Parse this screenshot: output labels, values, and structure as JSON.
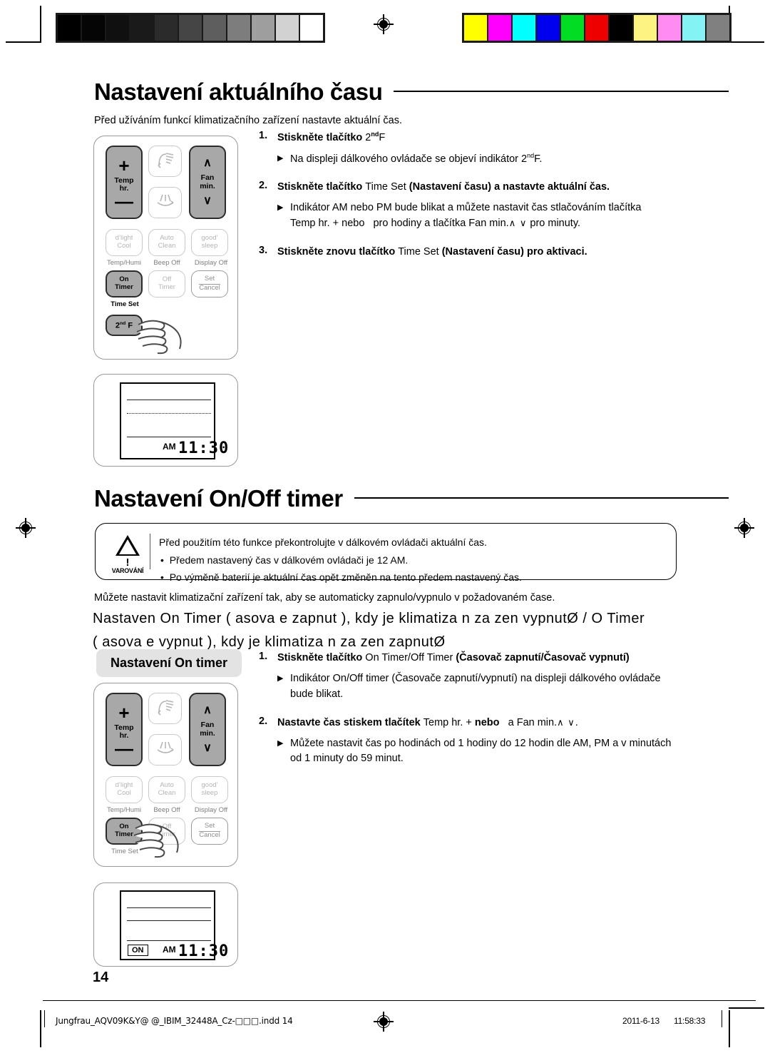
{
  "page": {
    "number": "14",
    "footer_file": "Jungfrau_AQV09K&Y@ @_IBIM_32448A_Cz-□□□.indd   14",
    "footer_date": "2011-6-13",
    "footer_time": "11:58:33"
  },
  "calibration": {
    "gray_swatches": [
      "#000000",
      "#050505",
      "#101010",
      "#1a1a1a",
      "#2b2b2b",
      "#454545",
      "#5e5e5e",
      "#7d7d7d",
      "#9e9e9e",
      "#d2d2d2",
      "#ffffff"
    ],
    "color_swatches": [
      "#ffff00",
      "#ff00ff",
      "#00ffff",
      "#0000ee",
      "#00dd22",
      "#ee0000",
      "#000000",
      "#fdf380",
      "#ff8cf0",
      "#83f3f3",
      "#808080"
    ]
  },
  "section1": {
    "title": "Nastavení aktuálního času",
    "intro": "Před užíváním funkcí klimatizačního zařízení nastavte aktuální čas.",
    "steps": [
      {
        "num": "1.",
        "text_a": "Stiskněte tlačítko ",
        "text_b": "2",
        "sup": "nd",
        "text_c": "F",
        "sub_a": "Na displeji dálkového ovládače se objeví indikátor 2",
        "sub_sup": "nd",
        "sub_b": "F."
      },
      {
        "num": "2.",
        "text_a": "Stiskněte tlačítko ",
        "text_b": "Time Set",
        "text_c": " (Nastavení času) a nastavte aktuální čas.",
        "sub_line1": "Indikátor AM nebo PM bude blikat a můžete nastavit čas stlačováním tlačítka",
        "sub_line2_a": "Temp hr. + nebo",
        "sub_line2_b": "pro hodiny a tlačítka Fan min.",
        "sub_line2_arrows": "∧ ∨",
        "sub_line2_c": "pro minuty."
      },
      {
        "num": "3.",
        "text_a": "Stiskněte znovu tlačítko ",
        "text_b": "Time Set",
        "text_c": " (Nastavení času) pro aktivaci."
      }
    ]
  },
  "section2": {
    "title": "Nastavení On/Off timer",
    "warning": {
      "label": "VAROVÁNÍ",
      "icon": "warning-triangle-icon",
      "line1": "Před použitím této funkce překontrolujte v dálkovém ovládači aktuální čas.",
      "bullets": [
        "Předem nastavený čas v dálkovém ovládači je 12 AM.",
        "Po výměně baterií je aktuální čas opět změněn na tento předem nastavený čas."
      ]
    },
    "para": "Můžete nastavit klimatizační zařízení tak, aby se automaticky zapnulo/vypnulo v požadovaném čase.",
    "glitch_line1": "Nastaven  On Timer (  asova  e zapnut ), kdy  je klimatiza n  za  zen  vypnutØ / O  Timer",
    "glitch_line2": "(  asova  e vypnut ), kdy  je klimatiza n  za  zen  zapnutØ",
    "pill_label": "Nastavení On timer",
    "steps": [
      {
        "num": "1.",
        "text_a": "Stiskněte tlačítko ",
        "text_b": "On Timer/Off Timer",
        "text_c": " (Časovač zapnutí/Časovač vypnutí)",
        "sub_line1": "Indikátor On/Off timer (Časovače zapnutí/vypnutí) na displeji dálkového ovládače",
        "sub_line2": "bude blikat."
      },
      {
        "num": "2.",
        "text_a": "Nastavte čas stiskem tlačítek ",
        "text_b": "Temp hr. +",
        "text_c": " nebo",
        "text_d": "a Fan min.",
        "arrows": "∧ ∨",
        "text_e": "."
      }
    ],
    "step2_subs": [
      "Můžete nastavit čas po hodinách od 1 hodiny do 12 hodin dle AM, PM a v minutách",
      "od 1 minuty do 59 minut."
    ]
  },
  "remote": {
    "temp_label_line1": "Temp",
    "temp_label_line2": "hr.",
    "plus": "+",
    "minus": "—",
    "fan_label_line1": "Fan",
    "fan_label_line2": "min.",
    "chevron_up": "∧",
    "chevron_down": "∨",
    "swing_up_icon": "swing-up-icon",
    "swing_down_icon": "swing-down-icon",
    "buttons": [
      {
        "l1": "d’light",
        "l2": "Cool",
        "sub": "Temp/Humi"
      },
      {
        "l1": "Auto",
        "l2": "Clean",
        "sub": "Beep Off"
      },
      {
        "l1": "good’",
        "l2": "sleep",
        "sub": "Display Off"
      }
    ],
    "row_timer": [
      {
        "l1": "On",
        "l2": "Timer",
        "sub": "Time Set"
      },
      {
        "l1": "Off",
        "l2": "Timer",
        "sub": ""
      },
      {
        "l1": "Set",
        "l2": "Cancel",
        "sub": ""
      }
    ],
    "secondf_a": "2",
    "secondf_sup": "nd",
    "secondf_b": "F"
  },
  "lcd": {
    "ampm": "AM",
    "time": "11:30",
    "on_indicator": "ON"
  }
}
